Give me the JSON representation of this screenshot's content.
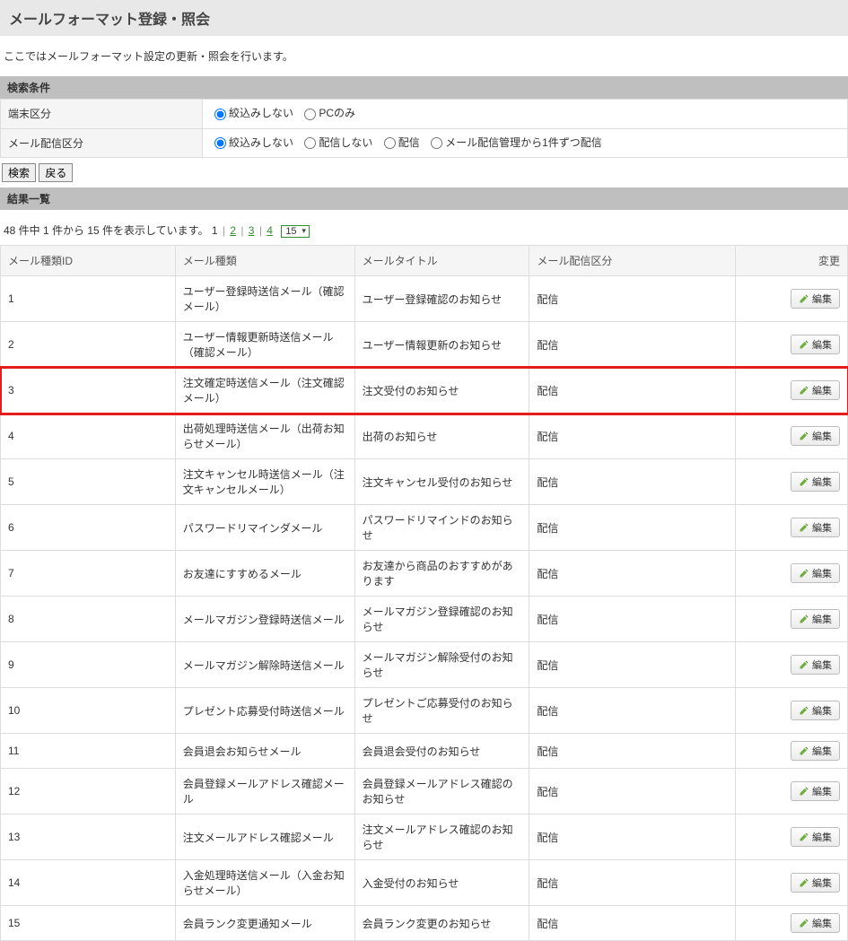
{
  "page": {
    "title": "メールフォーマット登録・照会",
    "description": "ここではメールフォーマット設定の更新・照会を行います。"
  },
  "sections": {
    "search": "検索条件",
    "results": "結果一覧"
  },
  "cond": {
    "terminal_label": "端末区分",
    "dist_label": "メール配信区分",
    "terminal_options": {
      "none": "絞込みしない",
      "pc": "PCのみ"
    },
    "dist_options": {
      "none": "絞込みしない",
      "no_send": "配信しない",
      "send": "配信",
      "per_item": "メール配信管理から1件ずつ配信"
    }
  },
  "buttons": {
    "search": "検索",
    "back": "戻る",
    "edit": "編集"
  },
  "pager": {
    "summary_prefix": "48 件中 1 件から 15 件を表示しています。",
    "pages": [
      "1",
      "2",
      "3",
      "4"
    ],
    "current_page": "1",
    "per_page": "15"
  },
  "table": {
    "headers": {
      "id": "メール種類ID",
      "type": "メール種類",
      "title": "メールタイトル",
      "dist": "メール配信区分",
      "edit": "変更"
    },
    "rows": [
      {
        "id": "1",
        "type": "ユーザー登録時送信メール（確認メール）",
        "title": "ユーザー登録確認のお知らせ",
        "dist": "配信",
        "highlight": false
      },
      {
        "id": "2",
        "type": "ユーザー情報更新時送信メール（確認メール）",
        "title": "ユーザー情報更新のお知らせ",
        "dist": "配信",
        "highlight": false
      },
      {
        "id": "3",
        "type": "注文確定時送信メール（注文確認メール）",
        "title": "注文受付のお知らせ",
        "dist": "配信",
        "highlight": true
      },
      {
        "id": "4",
        "type": "出荷処理時送信メール（出荷お知らせメール）",
        "title": "出荷のお知らせ",
        "dist": "配信",
        "highlight": false
      },
      {
        "id": "5",
        "type": "注文キャンセル時送信メール（注文キャンセルメール）",
        "title": "注文キャンセル受付のお知らせ",
        "dist": "配信",
        "highlight": false
      },
      {
        "id": "6",
        "type": "パスワードリマインダメール",
        "title": "パスワードリマインドのお知らせ",
        "dist": "配信",
        "highlight": false
      },
      {
        "id": "7",
        "type": "お友達にすすめるメール",
        "title": "お友達から商品のおすすめがあります",
        "dist": "配信",
        "highlight": false
      },
      {
        "id": "8",
        "type": "メールマガジン登録時送信メール",
        "title": "メールマガジン登録確認のお知らせ",
        "dist": "配信",
        "highlight": false
      },
      {
        "id": "9",
        "type": "メールマガジン解除時送信メール",
        "title": "メールマガジン解除受付のお知らせ",
        "dist": "配信",
        "highlight": false
      },
      {
        "id": "10",
        "type": "プレゼント応募受付時送信メール",
        "title": "プレゼントご応募受付のお知らせ",
        "dist": "配信",
        "highlight": false
      },
      {
        "id": "11",
        "type": "会員退会お知らせメール",
        "title": "会員退会受付のお知らせ",
        "dist": "配信",
        "highlight": false
      },
      {
        "id": "12",
        "type": "会員登録メールアドレス確認メール",
        "title": "会員登録メールアドレス確認のお知らせ",
        "dist": "配信",
        "highlight": false
      },
      {
        "id": "13",
        "type": "注文メールアドレス確認メール",
        "title": "注文メールアドレス確認のお知らせ",
        "dist": "配信",
        "highlight": false
      },
      {
        "id": "14",
        "type": "入金処理時送信メール（入金お知らせメール）",
        "title": "入金受付のお知らせ",
        "dist": "配信",
        "highlight": false
      },
      {
        "id": "15",
        "type": "会員ランク変更通知メール",
        "title": "会員ランク変更のお知らせ",
        "dist": "配信",
        "highlight": false
      }
    ]
  }
}
